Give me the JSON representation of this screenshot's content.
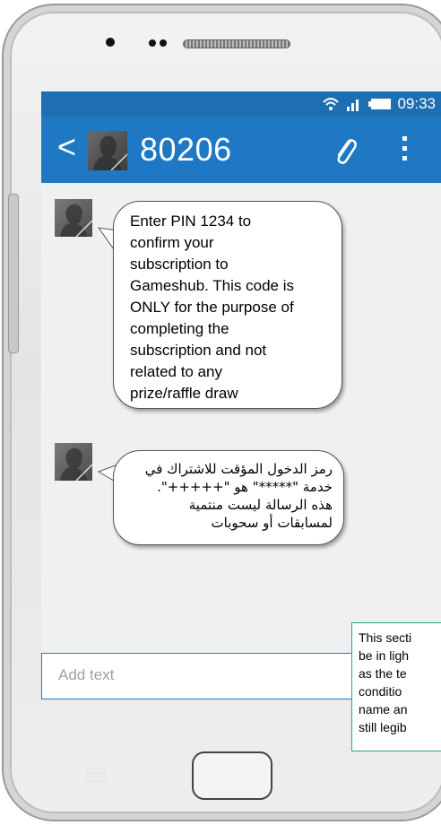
{
  "status_bar": {
    "time": "09:33",
    "icons": [
      "wifi-icon",
      "signal-icon",
      "battery-icon"
    ],
    "color": "#1e6fb2"
  },
  "app_bar": {
    "contact_name": "80206",
    "back_glyph": "<",
    "color": "#1f78c4"
  },
  "messages": [
    {
      "direction": "incoming",
      "lines": [
        "Enter PIN 1234 to",
        "confirm your",
        "subscription to",
        "Gameshub. This code is",
        "ONLY for the purpose of",
        "completing the",
        "subscription and not",
        "related to any",
        "prize/raffle draw"
      ]
    },
    {
      "direction": "incoming",
      "lines": [
        "رمز الدخول المؤقت للاشتراك في",
        "خدمة \"*****\" هو \"+++++\".",
        "هذه الرسالة ليست منتمية",
        "لمسابقات أو سحوبات"
      ]
    }
  ],
  "composer": {
    "placeholder": "Add text"
  },
  "annotation_note": {
    "lines": [
      "This secti",
      "be in ligh",
      "as the te",
      "conditio",
      "name an",
      "still legib"
    ],
    "border_color": "#2aa38a"
  }
}
